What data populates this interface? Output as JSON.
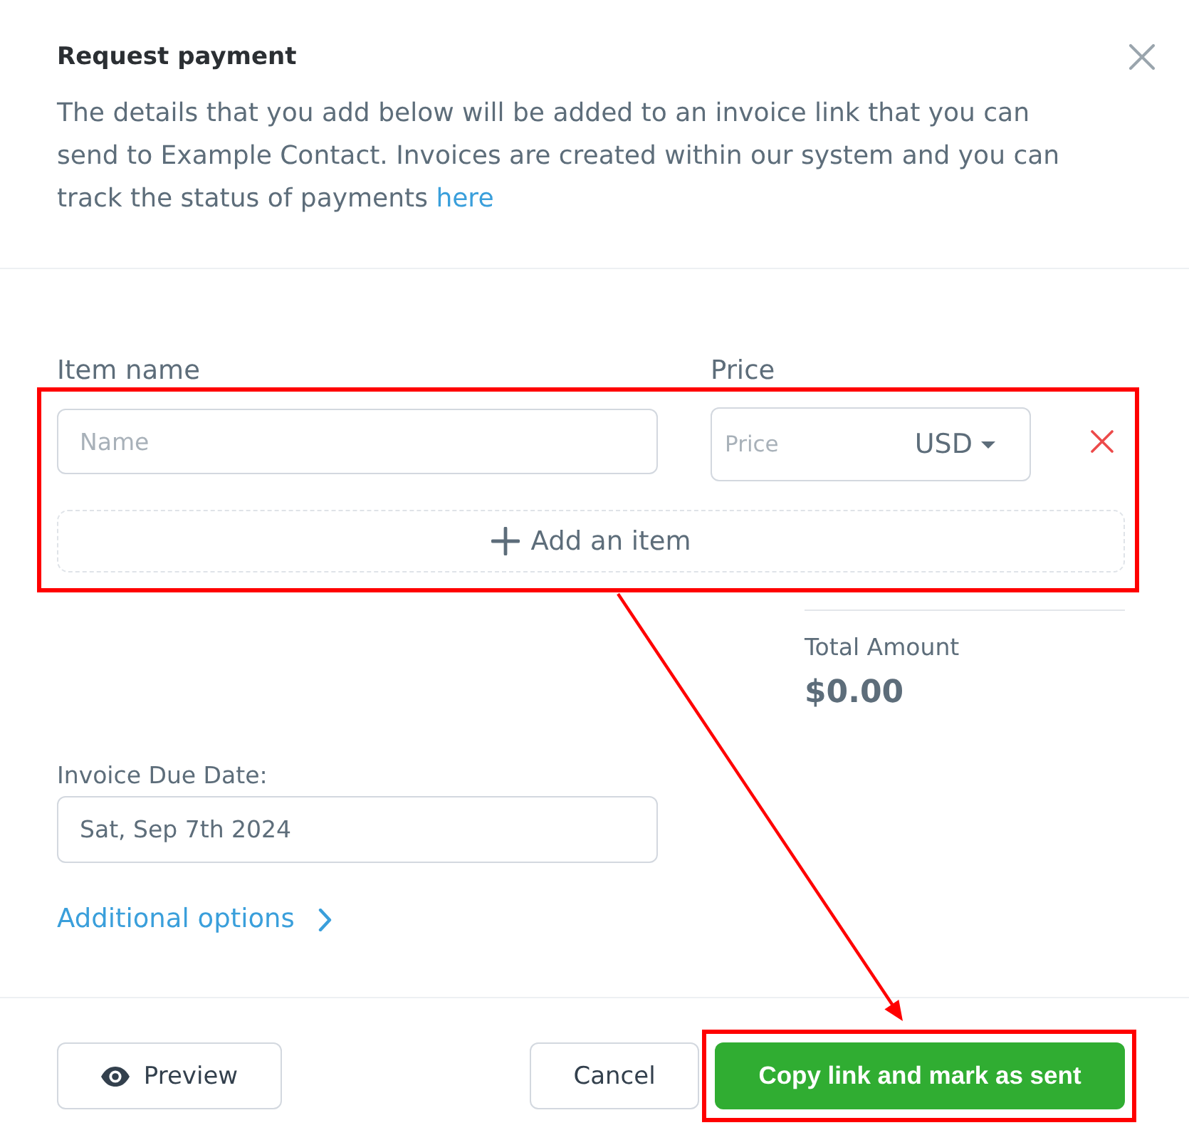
{
  "dialog": {
    "title": "Request payment",
    "description": {
      "text": "The details that you add below will be added to an invoice link that you can send to Example Contact. Invoices are created within our system and you can track the status of payments",
      "link": "here"
    }
  },
  "items": {
    "highlighted": true,
    "columns": [
      {
        "label": "Item name"
      },
      {
        "label": "Price"
      }
    ],
    "rows": [
      {
        "name": {
          "placeholder": "Name"
        },
        "price": {
          "placeholder": "Price",
          "currency": "USD"
        }
      }
    ],
    "add_button": "Add an item"
  },
  "total": {
    "label": "Total Amount",
    "value": "$0.00"
  },
  "due_date": {
    "label": "Invoice Due Date:",
    "value": "Sat, Sep 7th 2024"
  },
  "additional_options": {
    "label": "Additional options",
    "expanded": false
  },
  "footer": {
    "preview": "Preview",
    "cancel": "Cancel",
    "primary": {
      "label": "Copy link and mark as sent",
      "highlighted": true
    }
  }
}
